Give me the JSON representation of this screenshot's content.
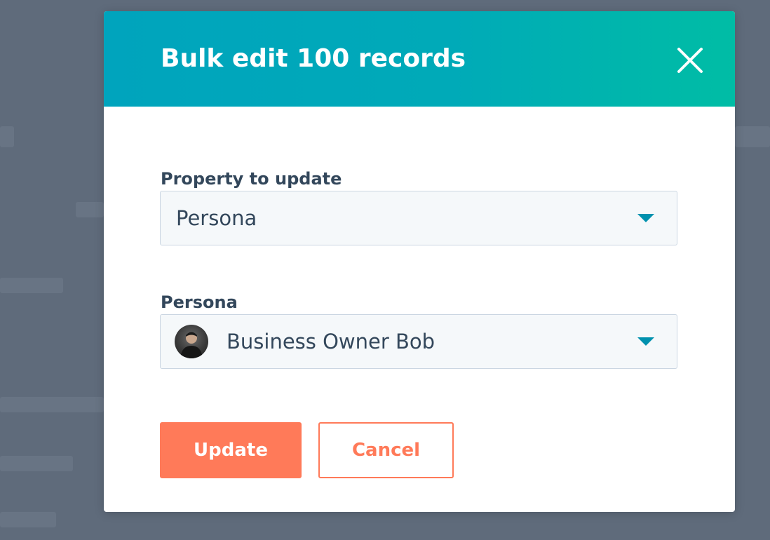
{
  "modal": {
    "title": "Bulk edit 100 records",
    "close_icon": "close-icon"
  },
  "fields": {
    "property": {
      "label": "Property to update",
      "value": "Persona",
      "caret_icon": "chevron-down-icon"
    },
    "persona": {
      "label": "Persona",
      "value": "Business Owner Bob",
      "avatar_icon": "avatar",
      "caret_icon": "chevron-down-icon"
    }
  },
  "buttons": {
    "update_label": "Update",
    "cancel_label": "Cancel"
  },
  "colors": {
    "header_gradient_start": "#00a4bd",
    "header_gradient_end": "#00bda5",
    "primary": "#ff7a59",
    "text": "#33475b",
    "caret": "#0091ae",
    "input_bg": "#f5f8fa",
    "input_border": "#cbd6e2",
    "backdrop": "#5f6b7b"
  }
}
